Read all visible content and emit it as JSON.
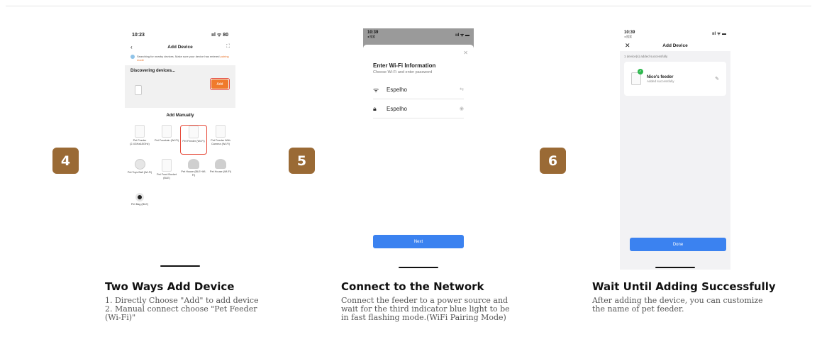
{
  "steps": [
    {
      "number": "4",
      "title": "Two Ways Add Device",
      "lines": [
        "1. Directly Choose \"Add\" to add device",
        "2. Manual connect choose \"Pet Feeder",
        "(Wi-Fi)\""
      ]
    },
    {
      "number": "5",
      "title": "Connect to the Network",
      "lines": [
        "Connect the feeder to a power source and",
        "wait for the third indicator blue light to be",
        "in fast flashing mode.(WiFi Pairing Mode)"
      ]
    },
    {
      "number": "6",
      "title": "Wait Until Adding Successfully",
      "lines": [
        "After adding the device, you can customize",
        "the name of pet feeder."
      ]
    }
  ],
  "phone1": {
    "time": "10:23",
    "status_icons": "ııl ᯤ 80",
    "back_icon": "chevron-left-icon",
    "title": "Add Device",
    "scan_icon": "scan-icon",
    "searching_text": "Searching for nearby devices. Make sure your device has entered",
    "searching_link": "pairing mode",
    "discovering": "Discovering devices...",
    "add_label": "Add",
    "manual_title": "Add Manually",
    "devices": [
      {
        "label": "Pet Feeder (2.4GHz&5GHz)",
        "icon": "feeder-icon"
      },
      {
        "label": "Pet Fountain (Wi-Fi)",
        "icon": "fountain-icon"
      },
      {
        "label": "Pet Feeder (Wi-Fi)",
        "icon": "feeder-icon"
      },
      {
        "label": "Pet Feeder With Camera (Wi-Fi)",
        "icon": "camera-feeder-icon"
      },
      {
        "label": "Pet Toys Ball (Wi-Fi)",
        "icon": "ball-icon"
      },
      {
        "label": "Pet Food Bucket (BLE)",
        "icon": "bucket-icon"
      },
      {
        "label": "Pet House (BLE+Wi-Fi)",
        "icon": "house-icon"
      },
      {
        "label": "Pet House (Wi-Fi)",
        "icon": "house-icon"
      },
      {
        "label": "Pet Bag (BLE)",
        "icon": "bag-camera-icon"
      }
    ]
  },
  "phone2": {
    "time": "10:39",
    "back_label": "◂ 搜索",
    "status_icons": "ııl ᯤ ▬",
    "close_icon": "close-icon",
    "title": "Enter Wi-Fi Information",
    "subtitle": "Choose Wi-Fi and enter password",
    "wifi_name": "Espelho",
    "password": "Espelho",
    "switch_icon": "switch-icon",
    "eye_icon": "eye-icon",
    "next_label": "Next"
  },
  "phone3": {
    "time": "10:39",
    "back_label": "◂ 搜索",
    "status_icons": "ııl ᯤ ▬",
    "title": "Add Device",
    "count_text": "1 device(s) added successfully",
    "device_name": "Nico's feeder",
    "device_status": "Added successfully",
    "done_label": "Done"
  }
}
